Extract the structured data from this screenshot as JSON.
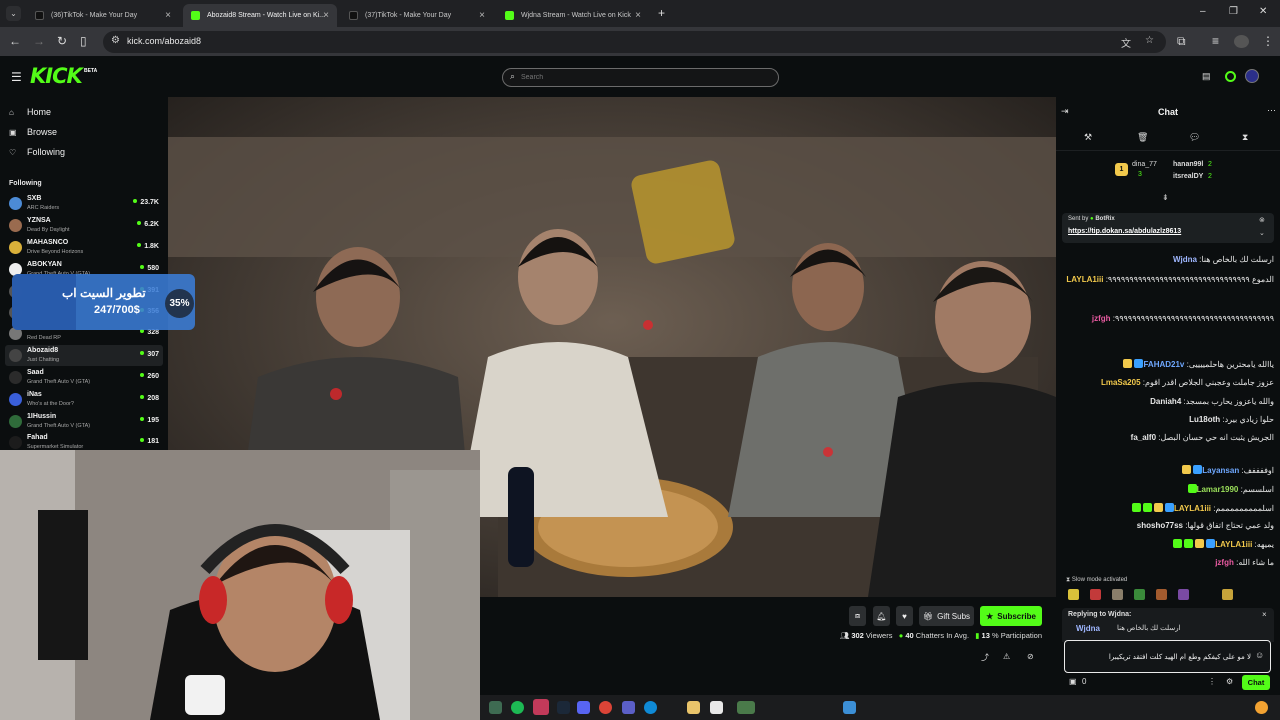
{
  "browser": {
    "tabs": [
      {
        "title": "(36)TikTok - Make Your Day",
        "fav": "#111111",
        "active": false
      },
      {
        "title": "Abozaid8 Stream - Watch Live on Ki...",
        "fav": "#53fc18",
        "active": true
      },
      {
        "title": "(37)TikTok - Make Your Day",
        "fav": "#111111",
        "active": false
      },
      {
        "title": "Wjdna Stream - Watch Live on Kick",
        "fav": "#53fc18",
        "active": false
      }
    ],
    "url": "kick.com/abozaid8"
  },
  "header": {
    "logo": "KICK",
    "beta": "BETA",
    "search_placeholder": "Search"
  },
  "sidebar": {
    "nav": [
      {
        "label": "Home",
        "icon": "home-icon"
      },
      {
        "label": "Browse",
        "icon": "browse-icon"
      },
      {
        "label": "Following",
        "icon": "heart-icon"
      }
    ],
    "following_title": "Following",
    "channels": [
      {
        "name": "SXB",
        "category": "ARC Raiders",
        "viewers": "23.7K",
        "color": "#4c8bd6"
      },
      {
        "name": "YZNSA",
        "category": "Dead By Daylight",
        "viewers": "6.2K",
        "color": "#9a6b4f"
      },
      {
        "name": "MAHASNCO",
        "category": "Drive Beyond Horizons",
        "viewers": "1.8K",
        "color": "#d9b03a"
      },
      {
        "name": "ABOKYAN",
        "category": "Grand Theft Auto V (GTA)",
        "viewers": "580",
        "color": "#eeeeee"
      },
      {
        "name": "",
        "category": "",
        "viewers": "391",
        "color": "#555555"
      },
      {
        "name": "",
        "category": "",
        "viewers": "356",
        "color": "#555555"
      },
      {
        "name": "",
        "category": "Red Dead RP",
        "viewers": "328",
        "color": "#777777"
      },
      {
        "name": "Abozaid8",
        "category": "Just Chatting",
        "viewers": "307",
        "color": "#444444"
      },
      {
        "name": "Saad",
        "category": "Grand Theft Auto V (GTA)",
        "viewers": "260",
        "color": "#2b2b2b"
      },
      {
        "name": "iNas",
        "category": "Who's at the Door?",
        "viewers": "208",
        "color": "#3a5fd9"
      },
      {
        "name": "1IHussin",
        "category": "Grand Theft Auto V (GTA)",
        "viewers": "195",
        "color": "#2f6b3a"
      },
      {
        "name": "Fahad",
        "category": "Supermarket Simulator",
        "viewers": "181",
        "color": "#1c1c1c"
      }
    ]
  },
  "goal": {
    "title": "تطوير السيت اب",
    "progress_text": "247/700$",
    "percent_label": "35%",
    "fraction": 0.35
  },
  "stream": {
    "buttons": {
      "gift": "Gift Subs",
      "subscribe": "Subscribe"
    },
    "viewers": "302",
    "viewers_label": "Viewers",
    "chatters": "40",
    "chatters_label": "Chatters In Avg.",
    "participation": "13",
    "participation_label": "% Participation"
  },
  "chat": {
    "title": "Chat",
    "podium": {
      "first": "dina_77",
      "first_count": "3",
      "second": "hanan99l",
      "second_count": "2",
      "third": "itsrealDY",
      "third_count": "2"
    },
    "pinned_sender": "Sent by",
    "pinned_bot": "BotRix",
    "pinned_link": "https://tip.dokan.sa/abdulazlz8613",
    "messages": [
      {
        "user": "Wjdna",
        "color": "#9fb7ff",
        "text": "ارسلت لك بالخاص هنا",
        "badges": []
      },
      {
        "user": "LAYLA1iii",
        "color": "#f2c94c",
        "text": "الدموع ٩٩٩٩٩٩٩٩٩٩٩٩٩٩٩٩٩٩٩٩٩٩٩٩٩٩٩٩٩٩٩٩٩",
        "badges": [
          "#3aa0ff",
          "#f2c94c",
          "#53fc18",
          "#53fc18"
        ]
      },
      {
        "user": "jzfgh",
        "color": "#e85aa0",
        "text": "٩٩٩٩٩٩٩٩٩٩٩٩٩٩٩٩٩٩٩٩٩٩٩٩٩٩٩٩٩٩٩٩٩٩٩٩٩",
        "badges": []
      },
      {
        "user": "FAHAD21v",
        "color": "#6fa8ff",
        "text": "ياالله يامحترين هاحلمييييى",
        "badges": [
          "#3aa0ff",
          "#f2c94c"
        ]
      },
      {
        "user": "LmaSa205",
        "color": "#f2c94c",
        "text": "عزوز جاملت وعجبني الجلاص اقدر اقوم",
        "badges": []
      },
      {
        "user": "Daniah4",
        "color": "#e8e8e8",
        "text": "والله ياعزوز يحارب بمسجد",
        "badges": []
      },
      {
        "user": "Lu18oth",
        "color": "#e8e8e8",
        "text": "حلوا زيادي بيرد",
        "badges": []
      },
      {
        "user": "fa_alf0",
        "color": "#e8e8e8",
        "text": "الجريش يثبت انه حي حسان البصل",
        "badges": []
      },
      {
        "user": "Layansan",
        "color": "#6fa8ff",
        "text": "اوففففف",
        "badges": [
          "#3aa0ff",
          "#f2c94c"
        ]
      },
      {
        "user": "Lamar1990",
        "color": "#9be05a",
        "text": "اسلسسم",
        "badges": [
          "#53fc18"
        ]
      },
      {
        "user": "LAYLA1iii",
        "color": "#f2c94c",
        "text": "اسلمممممممممم",
        "badges": [
          "#3aa0ff",
          "#f2c94c",
          "#53fc18",
          "#53fc18"
        ]
      },
      {
        "user": "shosho77ss",
        "color": "#e8e8e8",
        "text": "ولد عمي تحتاج اتفاق قولها",
        "badges": []
      },
      {
        "user": "LAYLA1iii",
        "color": "#f2c94c",
        "text": "يميهه",
        "badges": [
          "#3aa0ff",
          "#f2c94c",
          "#53fc18",
          "#53fc18"
        ]
      },
      {
        "user": "jzfgh",
        "color": "#e85aa0",
        "text": "ما شاء الله",
        "badges": []
      }
    ],
    "slow_mode": "Slow mode activated",
    "reply_to_label": "Replying to Wjdna:",
    "reply_user": "Wjdna",
    "reply_text": "ارسلت لك بالخاص هنا",
    "input_value": "لا مو على كيفكم وطع ام الهيد كلت افتقد تريكيبرا",
    "send_label": "Chat",
    "points": "0"
  }
}
